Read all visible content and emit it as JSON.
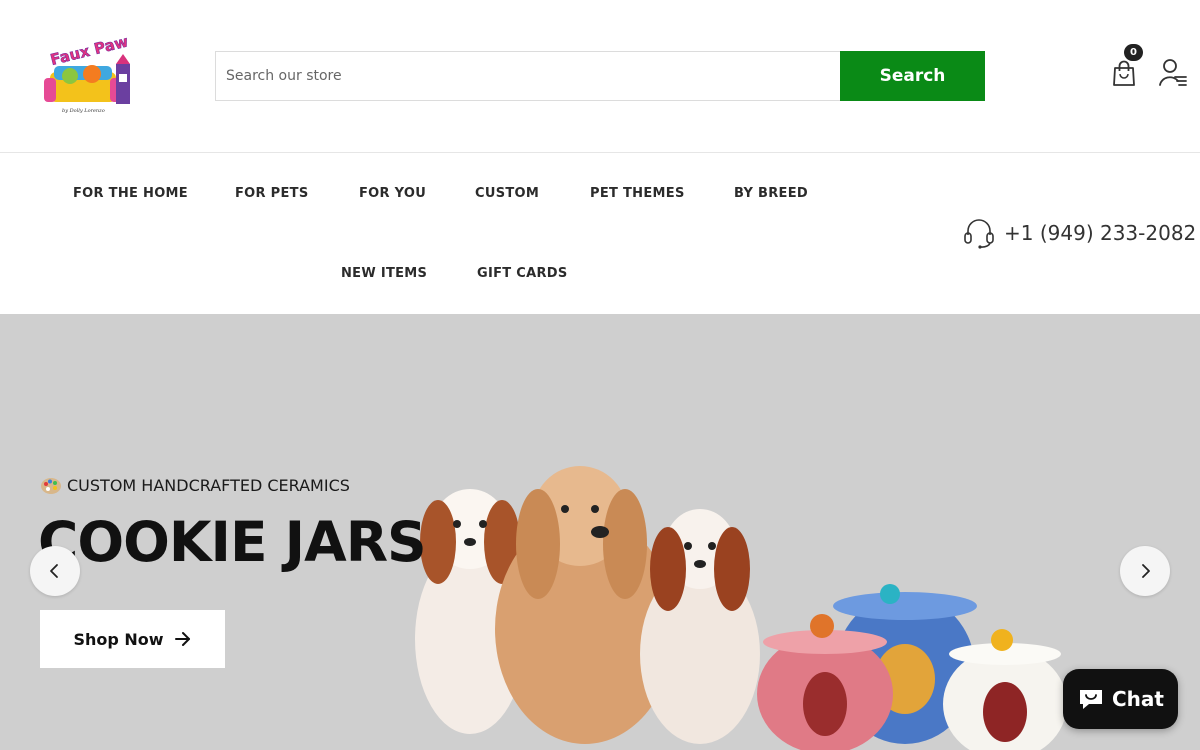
{
  "header": {
    "logo_text": "Faux Paw",
    "logo_sub": "by Dolly Lorenzo",
    "search": {
      "placeholder": "Search our store",
      "button_label": "Search"
    },
    "cart": {
      "count": "0",
      "icon": "shopping-bag-icon"
    },
    "account": {
      "icon": "user-account-icon"
    }
  },
  "nav": {
    "items": [
      {
        "label": "FOR THE HOME"
      },
      {
        "label": "FOR PETS"
      },
      {
        "label": "FOR YOU"
      },
      {
        "label": "CUSTOM"
      },
      {
        "label": "PET THEMES"
      },
      {
        "label": "BY BREED"
      },
      {
        "label": "NEW ITEMS"
      },
      {
        "label": "GIFT CARDS"
      }
    ],
    "phone": {
      "icon": "headset-icon",
      "number": "+1 (949) 233-2082"
    }
  },
  "hero": {
    "eyebrow_icon": "palette-icon",
    "eyebrow": "CUSTOM HANDCRAFTED CERAMICS",
    "title": "COOKIE JARS",
    "cta_label": "Shop Now",
    "cta_icon": "arrow-right-icon",
    "prev_icon": "chevron-left-icon",
    "next_icon": "chevron-right-icon",
    "background": "#cfcfcf"
  },
  "chat": {
    "label": "Chat",
    "icon": "chat-bubble-icon"
  },
  "colors": {
    "accent": "#0a8a16",
    "text": "#222222"
  }
}
